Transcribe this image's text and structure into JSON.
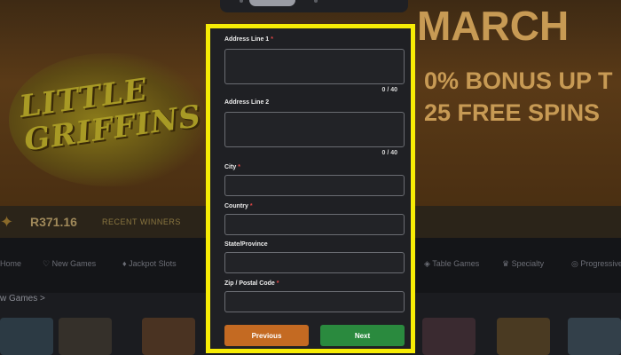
{
  "background": {
    "logo_text": "LITTLE GRIFFINS",
    "promo": {
      "line1": "MARCH",
      "line2": "0% BONUS UP T",
      "line3": "25 FREE SPINS"
    },
    "jackpot": {
      "amount": "R371.16",
      "label": "RECENT WINNERS"
    },
    "nav": [
      "Home",
      "New Games",
      "Jackpot Slots",
      "Table Games",
      "Specialty",
      "Progressive"
    ],
    "section_title": "w Games >"
  },
  "form": {
    "fields": [
      {
        "label": "Address Line 1",
        "required": true,
        "type": "textarea",
        "value": "",
        "counter": "0 / 40"
      },
      {
        "label": "Address Line 2",
        "required": false,
        "type": "textarea",
        "value": "",
        "counter": "0 / 40"
      },
      {
        "label": "City",
        "required": true,
        "type": "text",
        "value": ""
      },
      {
        "label": "Country",
        "required": true,
        "type": "text",
        "value": ""
      },
      {
        "label": "State/Province",
        "required": false,
        "type": "text",
        "value": ""
      },
      {
        "label": "Zip / Postal Code",
        "required": true,
        "type": "text",
        "value": ""
      }
    ],
    "required_marker": "*",
    "buttons": {
      "previous": "Previous",
      "next": "Next"
    }
  },
  "colors": {
    "highlight_border": "#f7ec05",
    "previous_button": "#c46a22",
    "next_button": "#2a8a3e",
    "required_marker": "#e24646"
  }
}
